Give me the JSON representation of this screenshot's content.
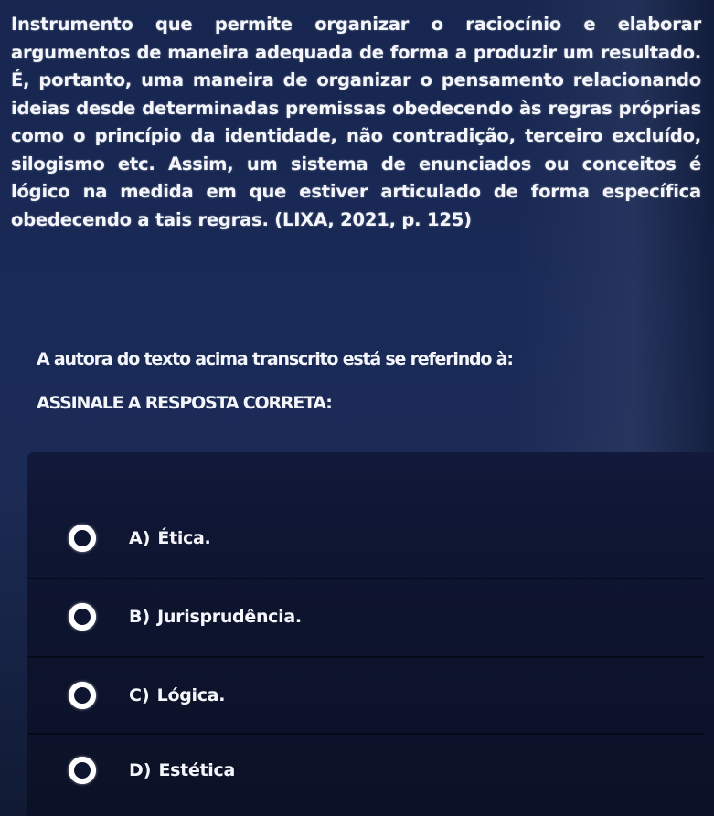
{
  "question": {
    "text": "Instrumento que permite organizar o raciocínio e elaborar argumentos de maneira adequada de forma a produzir um resultado. É, portanto, uma maneira de organizar o pensamento relacionando ideias desde determinadas premissas obedecendo às regras próprias como o princípio da identidade, não contradição, terceiro excluído, silogismo etc. Assim, um sistema de enunciados ou conceitos é lógico na medida em que estiver articulado de forma específica obedecendo a tais regras. (LIXA, 2021, p. 125)",
    "prompt": "A autora do texto acima transcrito está se referindo à:",
    "instruction": "ASSINALE A RESPOSTA CORRETA:"
  },
  "options": [
    {
      "letter": "A)",
      "text": "Ética."
    },
    {
      "letter": "B)",
      "text": "Jurisprudência."
    },
    {
      "letter": "C)",
      "text": "Lógica."
    },
    {
      "letter": "D)",
      "text": "Estética"
    }
  ],
  "colors": {
    "background": "#1a2a57",
    "panel": "#0e1530",
    "text": "#f4f6fb",
    "radio": "#ffffff"
  },
  "icons": {
    "radio": "radio-button-unselected-icon"
  }
}
